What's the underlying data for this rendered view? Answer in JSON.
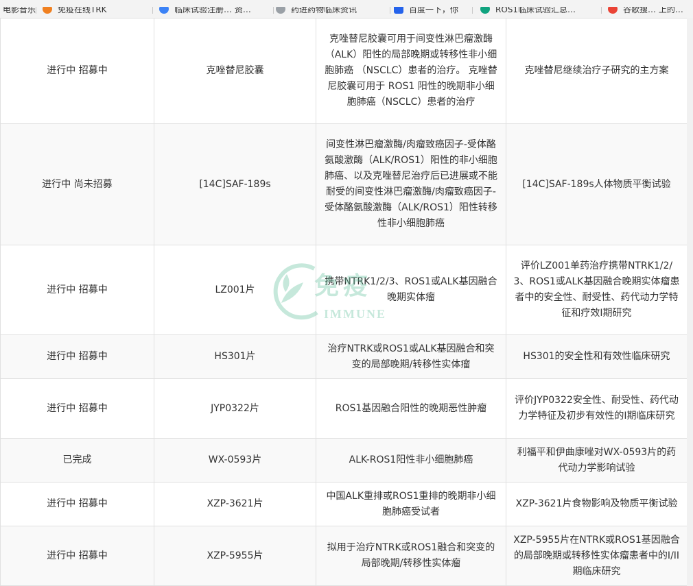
{
  "bookmarks": [
    {
      "label": "电影音乐",
      "icon": "page-icon",
      "color": "#d0d0d0"
    },
    {
      "label": "免疫在线TRK",
      "icon": "orange-swirl-icon",
      "color": "#f08020"
    },
    {
      "label": "临床试验注册…  资…",
      "icon": "blue-wings-icon",
      "color": "#3b82f6"
    },
    {
      "label": "药进药物临床资讯",
      "icon": "globe-icon",
      "color": "#9aa0a6"
    },
    {
      "label": "百度一下，你",
      "icon": "baidu-icon",
      "color": "#2563eb"
    },
    {
      "label": "ROS1临床试验汇总…",
      "icon": "leaf-icon",
      "color": "#10a37f"
    },
    {
      "label": "谷歌搜…  上的…",
      "icon": "google-icon",
      "color": "#ea4335"
    }
  ],
  "trials": [
    {
      "status": "进行中 招募中",
      "drug": "克唑替尼胶囊",
      "indication": "克唑替尼胶囊可用于间变性淋巴瘤激酶（ALK）阳性的局部晚期或转移性非小细胞肺癌 （NSCLC）患者的治疗。 克唑替尼胶囊可用于 ROS1 阳性的晚期非小细胞肺癌（NSCLC）患者的治疗",
      "title": "克唑替尼继续治疗子研究的主方案",
      "height": 154
    },
    {
      "status": "进行中 尚未招募",
      "drug": "[14C]SAF-189s",
      "indication": "间变性淋巴瘤激酶/肉瘤致癌因子-受体酪氨酸激酶（ALK/ROS1）阳性的非小细胞肺癌、以及克唑替尼治疗后已进展或不能耐受的间变性淋巴瘤激酶/肉瘤致癌因子-受体酪氨酸激酶（ALK/ROS1）阳性转移性非小细胞肺癌",
      "title": "[14C]SAF-189s人体物质平衡试验",
      "height": 177
    },
    {
      "status": "进行中 招募中",
      "drug": "LZ001片",
      "indication": "携带NTRK1/2/3、ROS1或ALK基因融合晚期实体瘤",
      "title": "评价LZ001单药治疗携带NTRK1/2/3、ROS1或ALK基因融合晚期实体瘤患者中的安全性、耐受性、药代动力学特征和疗效I期研究",
      "height": 131
    },
    {
      "status": "进行中 招募中",
      "drug": "HS301片",
      "indication": "治疗NTRK或ROS1或ALK基因融合和突变的局部晚期/转移性实体瘤",
      "title": "HS301的安全性和有效性临床研究",
      "height": 64
    },
    {
      "status": "进行中 招募中",
      "drug": "JYP0322片",
      "indication": "ROS1基因融合阳性的晚期恶性肿瘤",
      "title": "评价JYP0322安全性、耐受性、药代动力学特征及初步有效性的I期临床研究",
      "height": 87
    },
    {
      "status": "已完成",
      "drug": "WX-0593片",
      "indication": "ALK-ROS1阳性非小细胞肺癌",
      "title": "利福平和伊曲康唑对WX-0593片的药代动力学影响试验",
      "height": 64
    },
    {
      "status": "进行中 招募中",
      "drug": "XZP-3621片",
      "indication": "中国ALK重排或ROS1重排的晚期非小细胞肺癌受试者",
      "title": "XZP-3621片食物影响及物质平衡试验",
      "height": 64
    },
    {
      "status": "进行中 招募中",
      "drug": "XZP-5955片",
      "indication": "拟用于治疗NTRK或ROS1融合和突变的局部晚期/转移性实体瘤",
      "title": "XZP-5955片在NTRK或ROS1基因融合的局部晚期或转移性实体瘤患者中的I/II期临床研究",
      "height": 87
    },
    {
      "status": "",
      "drug": "",
      "indication": "",
      "title": "",
      "height": 30
    }
  ],
  "watermark": {
    "cn": "免疫",
    "en": "IMMUNE",
    "color": "#5fbf9a"
  }
}
